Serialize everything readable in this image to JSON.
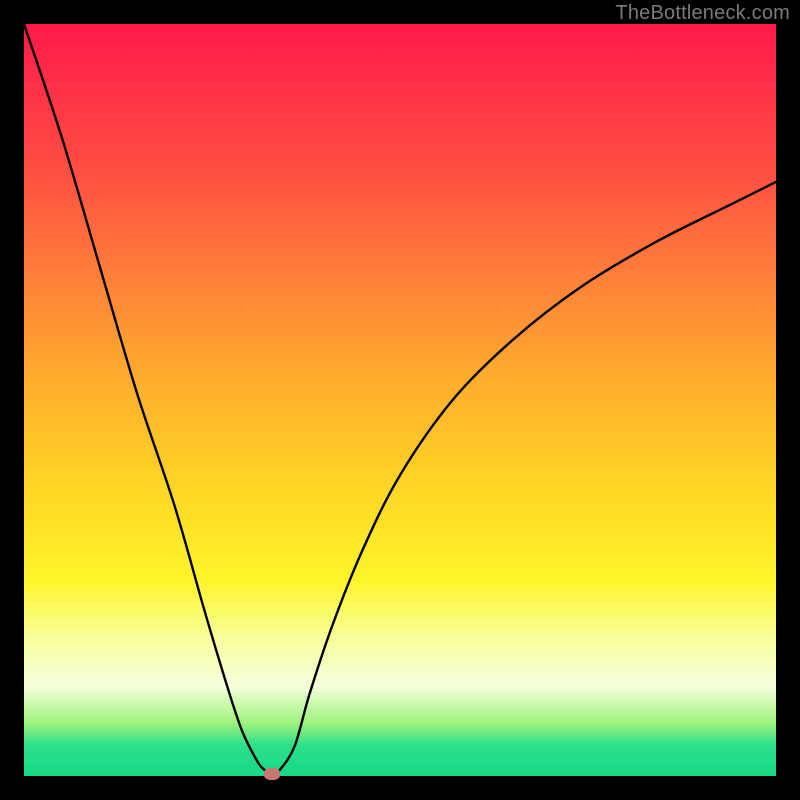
{
  "watermark": "TheBottleneck.com",
  "chart_data": {
    "type": "line",
    "title": "",
    "xlabel": "",
    "ylabel": "",
    "xlim": [
      0,
      100
    ],
    "ylim": [
      0,
      100
    ],
    "grid": false,
    "legend": false,
    "series": [
      {
        "name": "bottleneck-curve",
        "x": [
          0,
          5,
          10,
          15,
          20,
          24,
          27,
          29,
          31,
          32,
          33,
          34,
          36,
          38,
          41,
          45,
          50,
          57,
          65,
          74,
          84,
          94,
          100
        ],
        "y": [
          100,
          85,
          68,
          51,
          36,
          22,
          12,
          6,
          2,
          0.8,
          0.3,
          0.8,
          4,
          11,
          20,
          30,
          40,
          50,
          58,
          65,
          71,
          76,
          79
        ]
      }
    ],
    "marker": {
      "x": 33,
      "y": 0.3
    },
    "gradient_stops_pct": [
      0,
      18,
      32,
      46,
      61,
      74,
      82,
      88,
      93,
      96,
      100
    ],
    "gradient_colors": [
      "#ff1a4a",
      "#ff4a43",
      "#ff7a3a",
      "#ffa92e",
      "#ffd425",
      "#fff52a",
      "#f8ffa0",
      "#f6ffdc",
      "#9df27c",
      "#2ae08b",
      "#18d888"
    ]
  }
}
